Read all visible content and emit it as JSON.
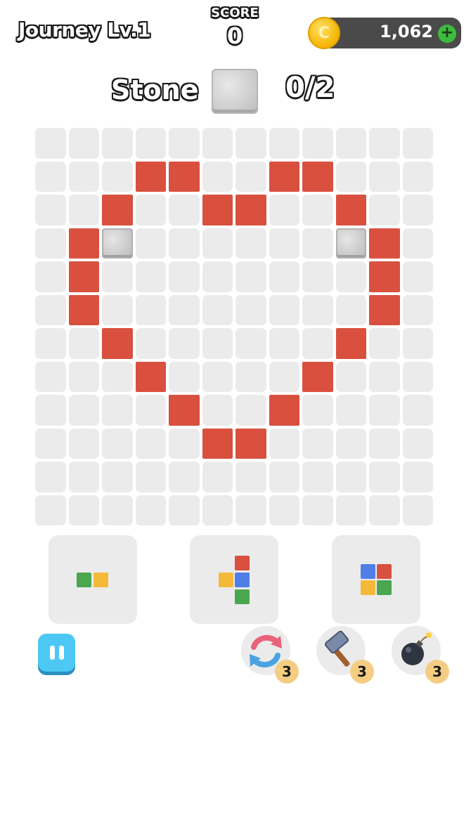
{
  "header": {
    "level_title": "Journey Lv.1",
    "score_label": "SCORE",
    "score_value": "0",
    "coins": "1,062",
    "coin_symbol": "C",
    "add_symbol": "+"
  },
  "goal": {
    "label": "Stone",
    "progress": "0/2",
    "icon": "stone-block"
  },
  "board": {
    "rows": 12,
    "cols": 12,
    "red_cells": [
      [
        1,
        3
      ],
      [
        1,
        4
      ],
      [
        1,
        7
      ],
      [
        1,
        8
      ],
      [
        2,
        2
      ],
      [
        2,
        5
      ],
      [
        2,
        6
      ],
      [
        2,
        9
      ],
      [
        3,
        1
      ],
      [
        3,
        10
      ],
      [
        4,
        1
      ],
      [
        4,
        10
      ],
      [
        5,
        1
      ],
      [
        5,
        10
      ],
      [
        6,
        2
      ],
      [
        6,
        9
      ],
      [
        7,
        3
      ],
      [
        7,
        8
      ],
      [
        8,
        4
      ],
      [
        8,
        7
      ],
      [
        9,
        5
      ],
      [
        9,
        6
      ]
    ],
    "stone_cells": [
      [
        3,
        2
      ],
      [
        3,
        9
      ]
    ],
    "colors": {
      "empty": "#ebebeb",
      "red": "#d9503f",
      "stone": "#cfcfcf"
    }
  },
  "pieces": [
    {
      "name": "piece-horizontal-pair",
      "blocks": [
        {
          "color": "green"
        },
        {
          "color": "yellow"
        }
      ]
    },
    {
      "name": "piece-plus-shape",
      "blocks": [
        {
          "color": "red"
        },
        {
          "color": "yellow"
        },
        {
          "color": "blue"
        },
        {
          "color": "green"
        }
      ]
    },
    {
      "name": "piece-square",
      "blocks": [
        {
          "color": "blue"
        },
        {
          "color": "red"
        },
        {
          "color": "yellow"
        },
        {
          "color": "green"
        }
      ]
    }
  ],
  "controls": {
    "pause_icon": "pause-icon"
  },
  "boosters": [
    {
      "name": "shuffle",
      "icon": "shuffle-icon",
      "count": "3"
    },
    {
      "name": "hammer",
      "icon": "hammer-icon",
      "count": "3"
    },
    {
      "name": "bomb",
      "icon": "bomb-icon",
      "count": "3"
    }
  ]
}
